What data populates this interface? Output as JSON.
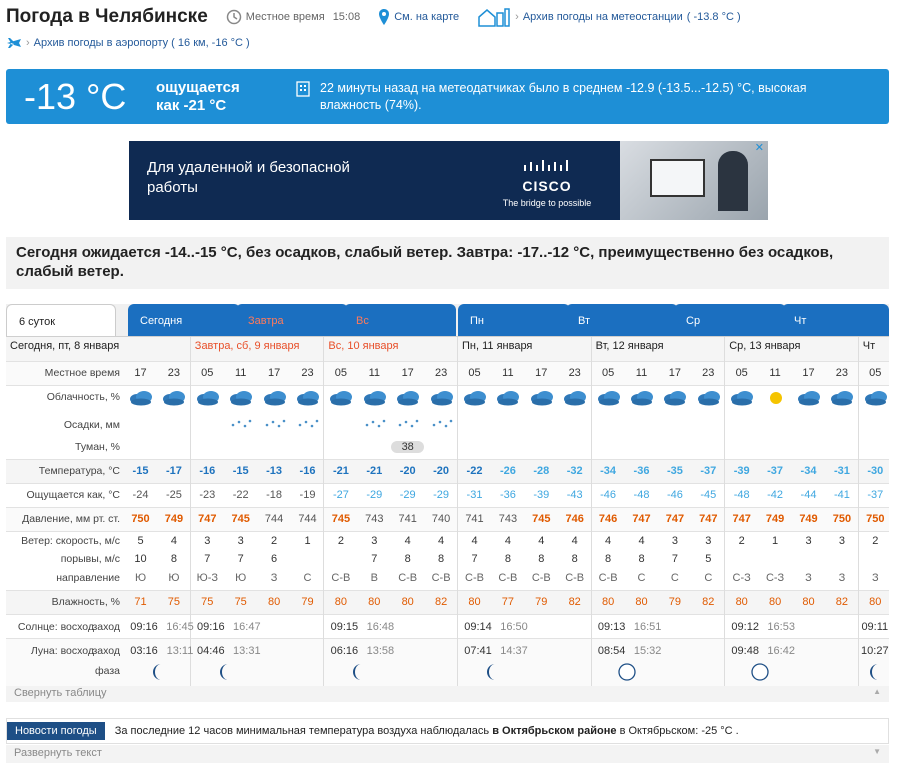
{
  "header": {
    "city_title": "Погода в Челябинске",
    "local_time_label": "Местное время",
    "local_time": "15:08",
    "map_link": "См. на карте",
    "station_archive": "Архив погоды на метеостанции",
    "station_temp": "( -13.8 °C )",
    "airport_archive": "Архив погоды в аэропорту ( 16 км, -16 °C )"
  },
  "now": {
    "temp": "-13 °C",
    "feels_line1": "ощущается",
    "feels_line2": "как -21 °C",
    "sensor_text": "22 минуты назад на метеодатчиках было в среднем -12.9 (-13.5...-12.5) °C, высокая влажность (74%)."
  },
  "ad": {
    "text_line1": "Для удаленной и безопасной",
    "text_line2": "работы",
    "brand": "CISCO",
    "tagline": "The bridge to possible"
  },
  "summary": "Сегодня ожидается -14..-15 °C, без осадков, слабый ветер. Завтра: -17..-12 °C, преимущественно без осадков, слабый ветер.",
  "tabs": [
    {
      "label": "6 суток",
      "red": false
    },
    {
      "label": "Сегодня",
      "red": false
    },
    {
      "label": "Завтра",
      "red": true
    },
    {
      "label": "Вс",
      "red": true
    },
    {
      "label": "Пн",
      "red": false
    },
    {
      "label": "Вт",
      "red": false
    },
    {
      "label": "Ср",
      "red": false
    },
    {
      "label": "Чт",
      "red": false
    }
  ],
  "days": [
    {
      "label": "Сегодня, пт, 8 января",
      "red": false
    },
    {
      "label": "Завтра, сб, 9 января",
      "red": true
    },
    {
      "label": "Вс, 10 января",
      "red": true
    },
    {
      "label": "Пн, 11 января",
      "red": false
    },
    {
      "label": "Вт, 12 января",
      "red": false
    },
    {
      "label": "Ср, 13 января",
      "red": false
    },
    {
      "label": "Чт",
      "red": false
    }
  ],
  "row_labels": {
    "time": "Местное время",
    "clouds": "Облачность, %",
    "precip": "Осадки, мм",
    "fog": "Туман, %",
    "temp": "Температура, °C",
    "feels": "Ощущается как, °C",
    "pressure": "Давление, мм рт. ст.",
    "wind": "Ветер: скорость, м/с",
    "gusts": "порывы, м/с",
    "direction": "направление",
    "humidity": "Влажность, %",
    "sun": "Солнце: восход",
    "sun_set": "заход",
    "moon": "Луна: восход",
    "moon_set": "заход",
    "phase": "фаза"
  },
  "times": [
    "17",
    "23",
    "05",
    "11",
    "17",
    "23",
    "05",
    "11",
    "17",
    "23",
    "05",
    "11",
    "17",
    "23",
    "05",
    "11",
    "17",
    "23",
    "05",
    "11",
    "17",
    "23",
    "05"
  ],
  "fog_value": "38",
  "temps": [
    "-15",
    "-17",
    "-16",
    "-15",
    "-13",
    "-16",
    "-21",
    "-21",
    "-20",
    "-20",
    "-22",
    "-26",
    "-28",
    "-32",
    "-34",
    "-36",
    "-35",
    "-37",
    "-39",
    "-37",
    "-34",
    "-31",
    "-30"
  ],
  "feels": [
    "-24",
    "-25",
    "-23",
    "-22",
    "-18",
    "-19",
    "-27",
    "-29",
    "-29",
    "-29",
    "-31",
    "-36",
    "-39",
    "-43",
    "-46",
    "-48",
    "-46",
    "-45",
    "-48",
    "-42",
    "-44",
    "-41",
    "-37"
  ],
  "pressure": [
    "750",
    "749",
    "747",
    "745",
    "744",
    "744",
    "745",
    "743",
    "741",
    "740",
    "741",
    "743",
    "745",
    "746",
    "746",
    "747",
    "747",
    "747",
    "747",
    "749",
    "749",
    "750",
    "750"
  ],
  "wind": [
    "5",
    "4",
    "3",
    "3",
    "2",
    "1",
    "2",
    "3",
    "4",
    "4",
    "4",
    "4",
    "4",
    "4",
    "4",
    "4",
    "3",
    "3",
    "2",
    "1",
    "3",
    "3",
    "2"
  ],
  "gusts": [
    "10",
    "8",
    "7",
    "7",
    "6",
    "",
    "",
    "7",
    "8",
    "8",
    "7",
    "8",
    "8",
    "8",
    "8",
    "8",
    "7",
    "5",
    "",
    "",
    "",
    "",
    ""
  ],
  "direction": [
    "Ю",
    "Ю",
    "Ю-З",
    "Ю",
    "З",
    "С",
    "С-В",
    "В",
    "С-В",
    "С-В",
    "С-В",
    "С-В",
    "С-В",
    "С-В",
    "С-В",
    "С",
    "С",
    "С",
    "С-З",
    "С-З",
    "З",
    "З",
    "З"
  ],
  "humidity": [
    "71",
    "75",
    "75",
    "75",
    "80",
    "79",
    "80",
    "80",
    "80",
    "82",
    "80",
    "77",
    "79",
    "82",
    "80",
    "80",
    "79",
    "82",
    "80",
    "80",
    "80",
    "82",
    "80"
  ],
  "sun": [
    [
      "09:16",
      "16:45"
    ],
    [
      "09:16",
      "16:47"
    ],
    [
      "09:15",
      "16:48"
    ],
    [
      "09:14",
      "16:50"
    ],
    [
      "09:13",
      "16:51"
    ],
    [
      "09:12",
      "16:53"
    ],
    [
      "09:11",
      ""
    ]
  ],
  "moon": [
    [
      "03:16",
      "13:11"
    ],
    [
      "04:46",
      "13:31"
    ],
    [
      "06:16",
      "13:58"
    ],
    [
      "07:41",
      "14:37"
    ],
    [
      "08:54",
      "15:32"
    ],
    [
      "09:48",
      "16:42"
    ],
    [
      "10:27",
      ""
    ]
  ],
  "collapse_label": "Свернуть таблицу",
  "news": {
    "button": "Новости погоды",
    "text_a": "За последние 12 часов минимальная температура воздуха наблюдалась",
    "text_b": "в Октябрьском районе",
    "text_c": "в Октябрьском: -25 °C .",
    "expand": "Развернуть текст"
  },
  "colors": {
    "brand_blue": "#1e8fd6",
    "tab_blue": "#1b6fc0",
    "temp_blue": "#1e73be",
    "temp_light": "#3fa7e0",
    "pressure_orange": "#e05a00",
    "red_day": "#e8502a"
  }
}
